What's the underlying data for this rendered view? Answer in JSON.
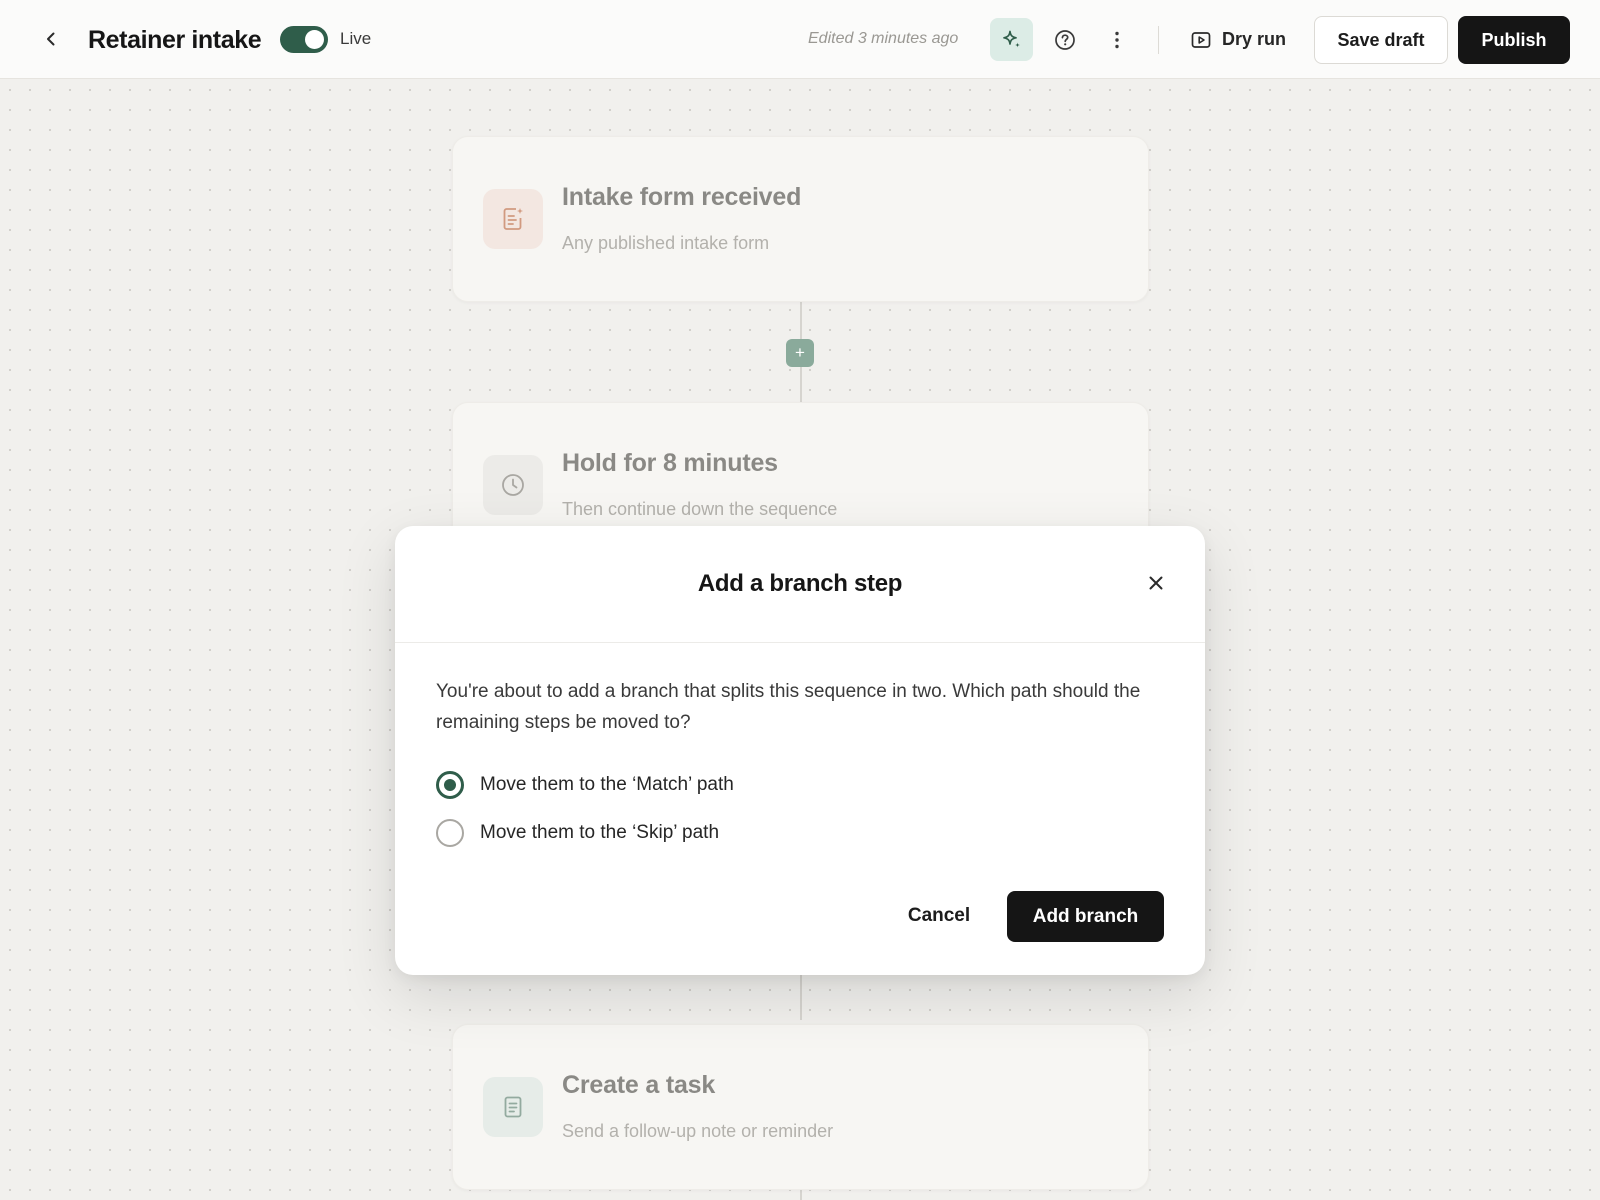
{
  "header": {
    "title": "Retainer intake",
    "live_toggle_on": true,
    "live_label": "Live",
    "edited_text": "Edited 3 minutes ago",
    "dry_run_label": "Dry run",
    "save_draft_label": "Save draft",
    "publish_label": "Publish"
  },
  "steps": [
    {
      "title": "Intake form received",
      "subtitle": "Any published intake form",
      "icon": "form-icon"
    },
    {
      "title": "Hold for 8 minutes",
      "subtitle": "Then continue down the sequence",
      "icon": "clock-icon"
    },
    {
      "title": "Create a task",
      "subtitle": "Send a follow-up note or reminder",
      "icon": "task-icon"
    }
  ],
  "add_step_symbol": "+",
  "modal": {
    "title": "Add a branch step",
    "description": "You're about to add a branch that splits this sequence in two. Which path should the remaining steps be moved to?",
    "options": [
      {
        "label": "Move them to the ‘Match’ path",
        "selected": true
      },
      {
        "label": "Move them to the ‘Skip’ path",
        "selected": false
      }
    ],
    "cancel_label": "Cancel",
    "confirm_label": "Add branch"
  },
  "colors": {
    "accent": "#2f5d4a",
    "primary_button": "#151515",
    "canvas": "#f1f0ed"
  }
}
